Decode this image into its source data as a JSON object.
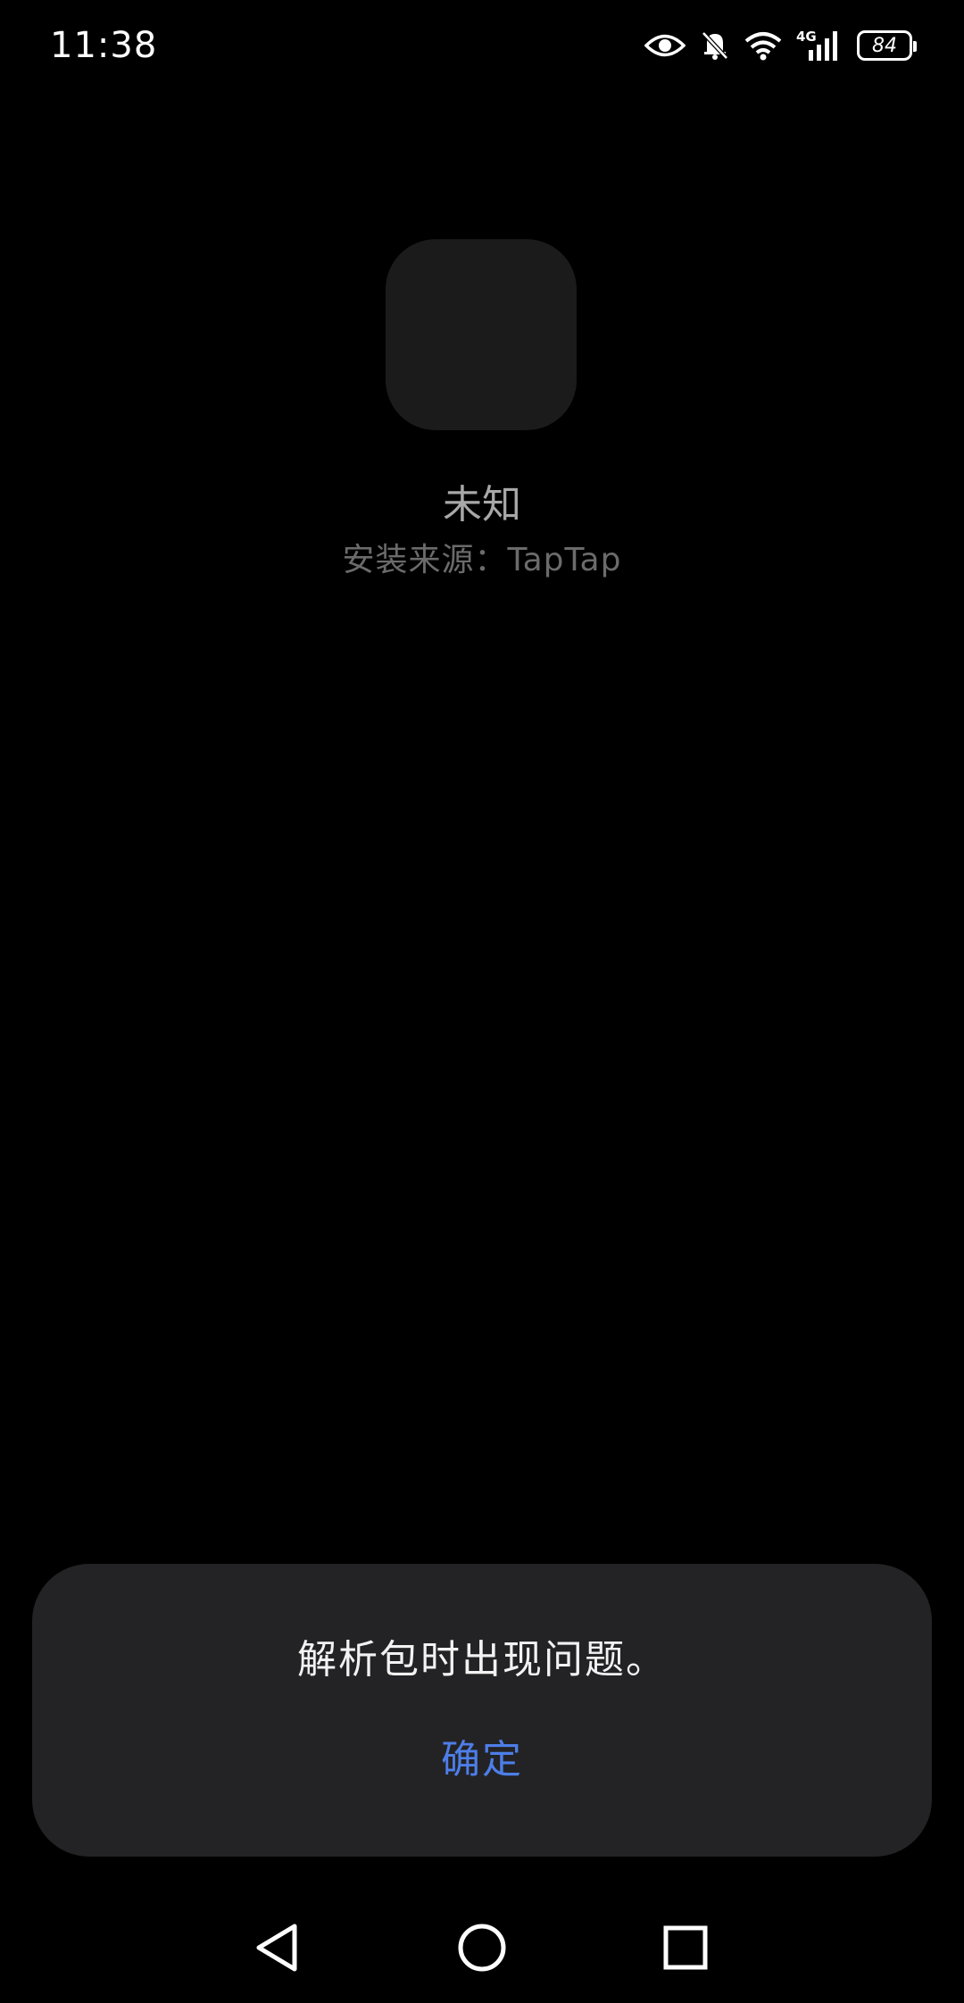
{
  "status_bar": {
    "time": "11:38",
    "network": "4G",
    "battery": "84",
    "icons": [
      "eye-icon",
      "bell-off-icon",
      "wifi-icon",
      "signal-icon",
      "battery-icon"
    ]
  },
  "app": {
    "name": "未知",
    "install_source": "安装来源：TapTap"
  },
  "dialog": {
    "message": "解析包时出现问题。",
    "confirm_label": "确定",
    "accent_color": "#4d7ee8"
  },
  "nav_bar": {
    "icons": [
      "back-icon",
      "home-icon",
      "recents-icon"
    ]
  }
}
